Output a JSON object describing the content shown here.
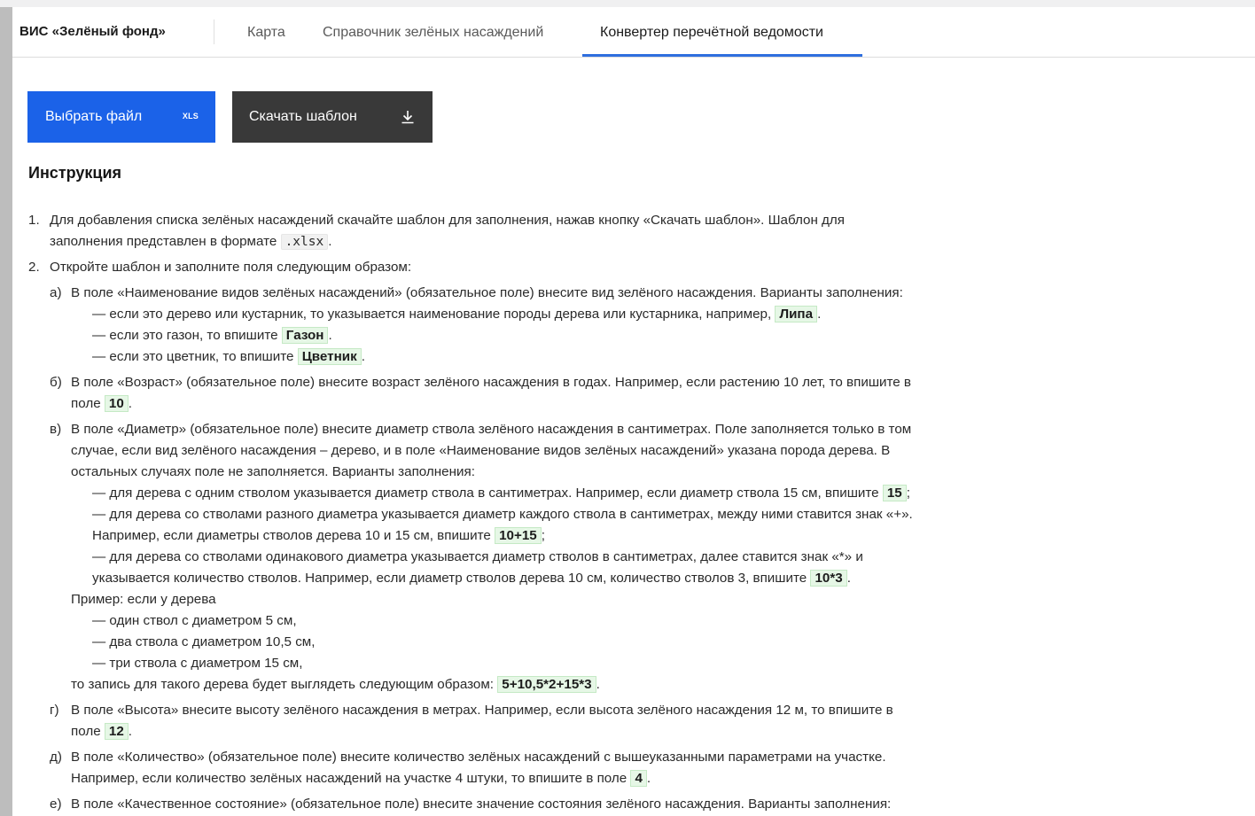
{
  "app": {
    "brand": "ВИС «Зелёный фонд»"
  },
  "nav": {
    "tabs": [
      {
        "label": "Карта",
        "active": false
      },
      {
        "label": "Справочник зелёных насаждений",
        "active": false
      },
      {
        "label": "Конвертер перечётной ведомости",
        "active": true
      }
    ]
  },
  "actions": {
    "choose_file": {
      "label": "Выбрать файл",
      "badge": "XLS",
      "color": "#1b62e8"
    },
    "download_template": {
      "label": "Скачать шаблон",
      "icon": "download-icon",
      "color": "#393939"
    }
  },
  "instructions": {
    "title": "Инструкция",
    "lines": [
      {
        "type": "num",
        "marker": "1.",
        "text": "Для добавления списка зелёных насаждений скачайте шаблон для заполнения, нажав кнопку «Скачать шаблон». Шаблон для"
      },
      {
        "type": "cont",
        "text": "заполнения представлен в формате",
        "code": ".xlsx",
        "after": "."
      },
      {
        "type": "num",
        "marker": "2.",
        "text": "Откройте шаблон и заполните поля следующим образом:"
      },
      {
        "type": "letter",
        "marker": "а)",
        "text": "В поле «Наименование видов зелёных насаждений» (обязательное поле) внесите вид зелёного насаждения. Варианты заполнения:"
      },
      {
        "type": "dash",
        "text": "— если это дерево или кустарник, то указывается наименование породы дерева или кустарника, например,",
        "tag": "Липа",
        "after": "."
      },
      {
        "type": "dash",
        "text": "— если это газон, то впишите",
        "tag": "Газон",
        "after": "."
      },
      {
        "type": "dash",
        "text": "— если это цветник, то впишите",
        "tag": "Цветник",
        "after": "."
      },
      {
        "type": "letter",
        "marker": "б)",
        "text": "В поле «Возраст» (обязательное поле) внесите возраст зелёного насаждения в годах. Например, если растению 10 лет, то впишите в"
      },
      {
        "type": "cont2",
        "text": "поле",
        "tag": "10",
        "after": "."
      },
      {
        "type": "letter",
        "marker": "в)",
        "text": "В поле «Диаметр» (обязательное поле) внесите диаметр ствола зелёного насаждения в сантиметрах. Поле заполняется только в том"
      },
      {
        "type": "cont2",
        "text": "случае, если вид зелёного насаждения  – дерево, и в поле «Наименование видов зелёных насаждений» указана порода дерева. В"
      },
      {
        "type": "cont2",
        "text": "остальных случаях поле не заполняется. Варианты заполнения:"
      },
      {
        "type": "dash",
        "text": "— для дерева с одним стволом указывается диаметр ствола в сантиметрах. Например, если диаметр ствола 15 см, впишите",
        "tag": "15",
        "after": ";"
      },
      {
        "type": "dash",
        "text": "— для дерева со стволами разного диаметра указывается диаметр каждого ствола в сантиметрах, между ними ставится знак «+»."
      },
      {
        "type": "dashc",
        "text": "Например, если диаметры стволов дерева 10 и 15 см, впишите",
        "tag": "10+15",
        "after": ";"
      },
      {
        "type": "dash",
        "text": "— для дерева со стволами одинакового диаметра указывается диаметр стволов в сантиметрах, далее ставится знак «*» и"
      },
      {
        "type": "dashc",
        "text": "указывается количество стволов. Например, если диаметр стволов дерева 10 см, количество стволов 3, впишите",
        "tag": "10*3",
        "after": "."
      },
      {
        "type": "cont2",
        "text": "Пример: если у дерева"
      },
      {
        "type": "dash",
        "text": "— один ствол с диаметром 5 см,"
      },
      {
        "type": "dash",
        "text": "— два ствола с диаметром 10,5 см,"
      },
      {
        "type": "dash",
        "text": "— три ствола с диаметром 15 см,"
      },
      {
        "type": "cont2",
        "text": "то запись для такого дерева будет выглядеть следующим образом:",
        "tag": "5+10,5*2+15*3",
        "after": "."
      },
      {
        "type": "letter",
        "marker": "г)",
        "text": "В поле «Высота» внесите высоту зелёного насаждения в метрах. Например, если высота зелёного насаждения 12 м, то впишите в"
      },
      {
        "type": "cont2",
        "text": "поле",
        "tag": "12",
        "after": "."
      },
      {
        "type": "letter",
        "marker": "д)",
        "text": "В поле «Количество» (обязательное поле) внесите количество зелёных насаждений с вышеуказанными параметрами на участке."
      },
      {
        "type": "cont2",
        "text": "Например, если количество зелёных насаждений на участке 4 штуки, то впишите в поле",
        "tag": "4",
        "after": "."
      },
      {
        "type": "letter",
        "marker": "е)",
        "text": "В поле «Качественное состояние» (обязательное поле) внесите значение состояния зелёного насаждения. Варианты заполнения:"
      }
    ]
  }
}
